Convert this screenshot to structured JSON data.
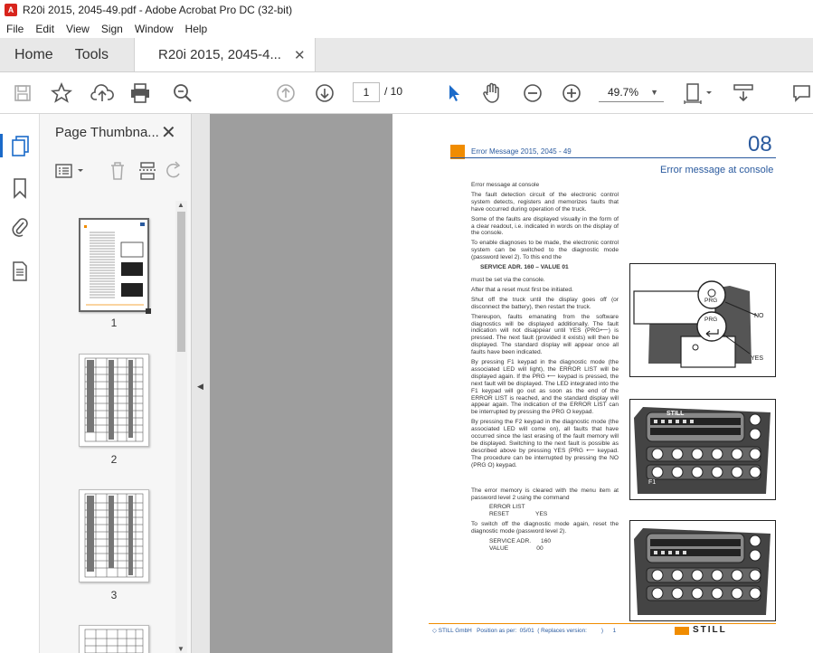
{
  "window": {
    "title": "R20i  2015, 2045-49.pdf - Adobe Acrobat Pro DC (32-bit)"
  },
  "menu": [
    "File",
    "Edit",
    "View",
    "Sign",
    "Window",
    "Help"
  ],
  "tabs": {
    "home": "Home",
    "tools": "Tools",
    "document": "R20i  2015, 2045-4..."
  },
  "toolbar": {
    "current_page": "1",
    "page_total": "/  10",
    "zoom": "49.7%"
  },
  "panel": {
    "title": "Page Thumbna...",
    "thumbnails": [
      "1",
      "2",
      "3"
    ]
  },
  "pdf": {
    "header_title": "Error Message  2015, 2045 - 49",
    "chapter": "08",
    "section_title": "Error message at console",
    "paragraphs": [
      "Error message at console",
      "The fault detection circuit of the electronic control system detects, registers and memorizes faults that have occurred during operation of the truck.",
      "Some of the faults are displayed visually in the form of a clear readout, i.e. indicated in words on the display of the console.",
      "To enable diagnoses to be made, the electronic control system can be switched to the diagnostic mode (password level 2). To this end the",
      "SERVICE ADR. 160  –  VALUE 01",
      "must be set via the console.",
      "After that a reset must first be initiated.",
      "Shut off the truck until the display goes off (or disconnect the battery), then restart the truck.",
      "Thereupon, faults emanating from the software diagnostics will be displayed additionally. The fault indication will not disappear until YES (PRG⟵) is pressed. The next fault (provided it exists) will then be displayed. The standard display will appear once all faults have been indicated.",
      "By pressing F1 keypad in the diagnostic mode (the associated LED will light), the ERROR LIST will be displayed again. If the PRG ⟵ keypad is pressed, the next fault will be displayed. The LED integrated into the F1 keypad will go out as soon as the end of the ERROR LIST is reached, and the standard display will appear again. The indication of the ERROR LIST can be interrupted by pressing the PRG O keypad.",
      "By pressing the F2 keypad in the diagnostic mode (the associated LED will come on), all faults that have occurred since the last erasing of the fault memory will be displayed. Switching to the next fault is possible as described above by pressing YES (PRG ⟵ keypad. The procedure can be interrupted by pressing the NO (PRG O) keypad.",
      "The error memory is cleared with the menu item at password level 2 using the command",
      "ERROR LIST",
      "RESET                YES",
      "To switch off the diagnostic mode again, reset the diagnostic mode (password level 2).",
      "SERVICE ADR.      160",
      "VALUE                 00"
    ],
    "figure1": {
      "prg_top": "PRG",
      "prg_bottom": "PRG",
      "no": "NO",
      "yes": "YES"
    },
    "footer": "◇ STILL GmbH   Position as per:  05/01  ( Replaces version:         )      1",
    "footer_logo": "STILL"
  },
  "colors": {
    "accent": "#2a5a9e",
    "orange": "#f08c00",
    "tab_bg": "#e8e8e8",
    "viewer_bg": "#9e9e9e"
  }
}
